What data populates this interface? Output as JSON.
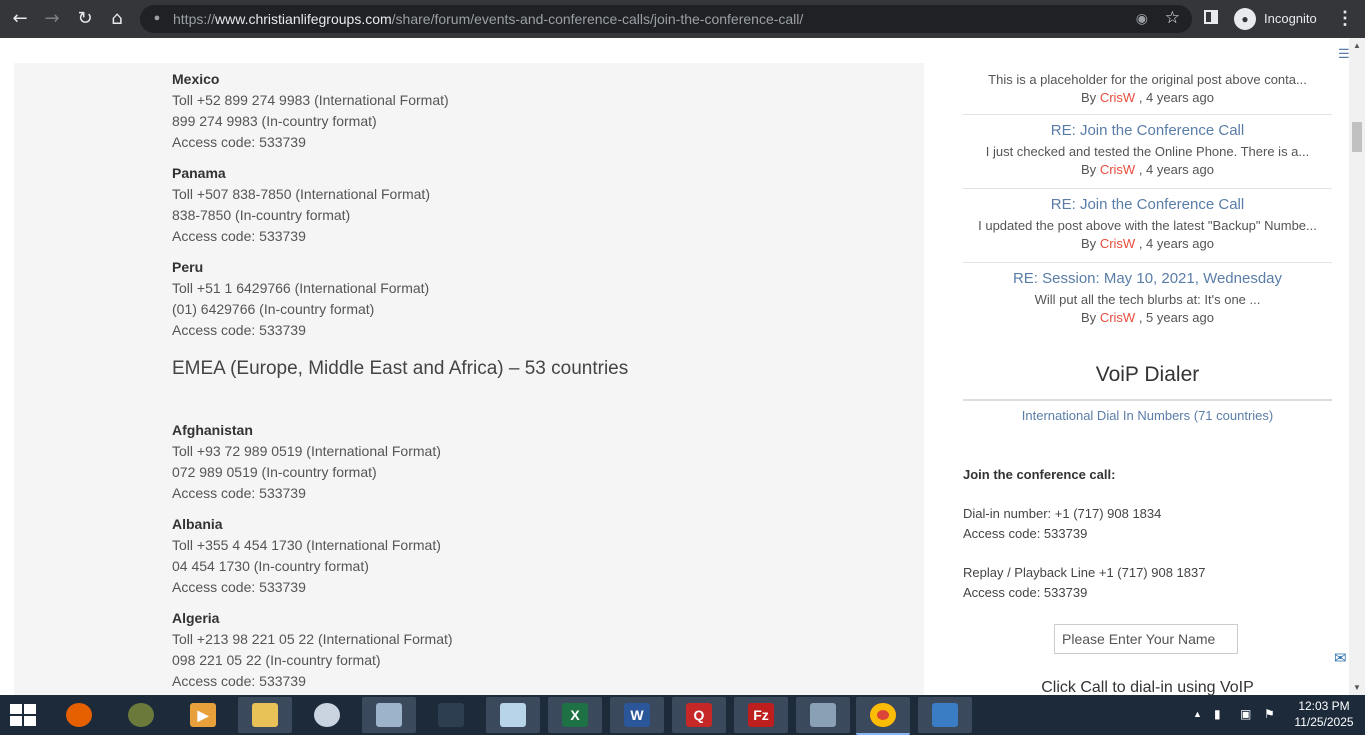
{
  "browser": {
    "url_scheme": "https://",
    "url_host": "www.christianlifegroups.com",
    "url_path": "/share/forum/events-and-conference-calls/join-the-conference-call/",
    "mode_label": "Incognito"
  },
  "countries_top": [
    {
      "name": "Mexico",
      "toll": "Toll +52 899 274 9983 (International Format)",
      "local": "899 274 9983 (In-country format)",
      "code": "Access code: 533739"
    },
    {
      "name": "Panama",
      "toll": "Toll +507 838-7850 (International Format)",
      "local": "838-7850 (In-country format)",
      "code": "Access code: 533739"
    },
    {
      "name": "Peru",
      "toll": "Toll +51 1 6429766 (International Format)",
      "local": "(01) 6429766 (In-country format)",
      "code": "Access code: 533739"
    }
  ],
  "section_title": "EMEA (Europe, Middle East and Africa) – 53 countries",
  "countries_emea": [
    {
      "name": "Afghanistan",
      "toll": "Toll +93 72 989 0519 (International Format)",
      "local": "072 989 0519 (In-country format)",
      "code": "Access code: 533739"
    },
    {
      "name": "Albania",
      "toll": "Toll +355 4 454 1730 (International Format)",
      "local": "04 454 1730 (In-country format)",
      "code": "Access code: 533739"
    },
    {
      "name": "Algeria",
      "toll": "Toll +213 98 221 05 22 (International Format)",
      "local": "098 221 05 22 (In-country format)",
      "code": "Access code: 533739"
    }
  ],
  "sidebar": {
    "posts": [
      {
        "title": "",
        "excerpt": "This is a placeholder for the original post above conta...",
        "by": "By",
        "author": "CrisW",
        "age": ", 4 years ago"
      },
      {
        "title": "RE: Join the Conference Call",
        "excerpt": "I just checked and tested the Online Phone. There is a...",
        "by": "By",
        "author": "CrisW",
        "age": ", 4 years ago"
      },
      {
        "title": "RE: Join the Conference Call",
        "excerpt": "I updated the post above with the latest \"Backup\" Numbe...",
        "by": "By",
        "author": "CrisW",
        "age": ", 4 years ago"
      },
      {
        "title": "RE: Session: May 10, 2021, Wednesday",
        "excerpt": "Will put all the tech blurbs at: It's one ...",
        "by": "By",
        "author": "CrisW",
        "age": ", 5 years ago"
      }
    ],
    "widget_title": "VoiP Dialer",
    "intl_link": "International Dial In Numbers (71 countries)",
    "join_heading": "Join the conference call:",
    "dialin": "Dial-in number: +1 (717) 908 1834",
    "access1": "Access code: 533739",
    "replay": "Replay / Playback Line +1 (717) 908 1837",
    "access2": "Access code: 533739",
    "name_placeholder": "Please Enter Your Name",
    "click_call": "Click Call to dial-in using VoIP"
  },
  "taskbar": {
    "time": "12:03 PM",
    "date": "11/25/2025"
  }
}
